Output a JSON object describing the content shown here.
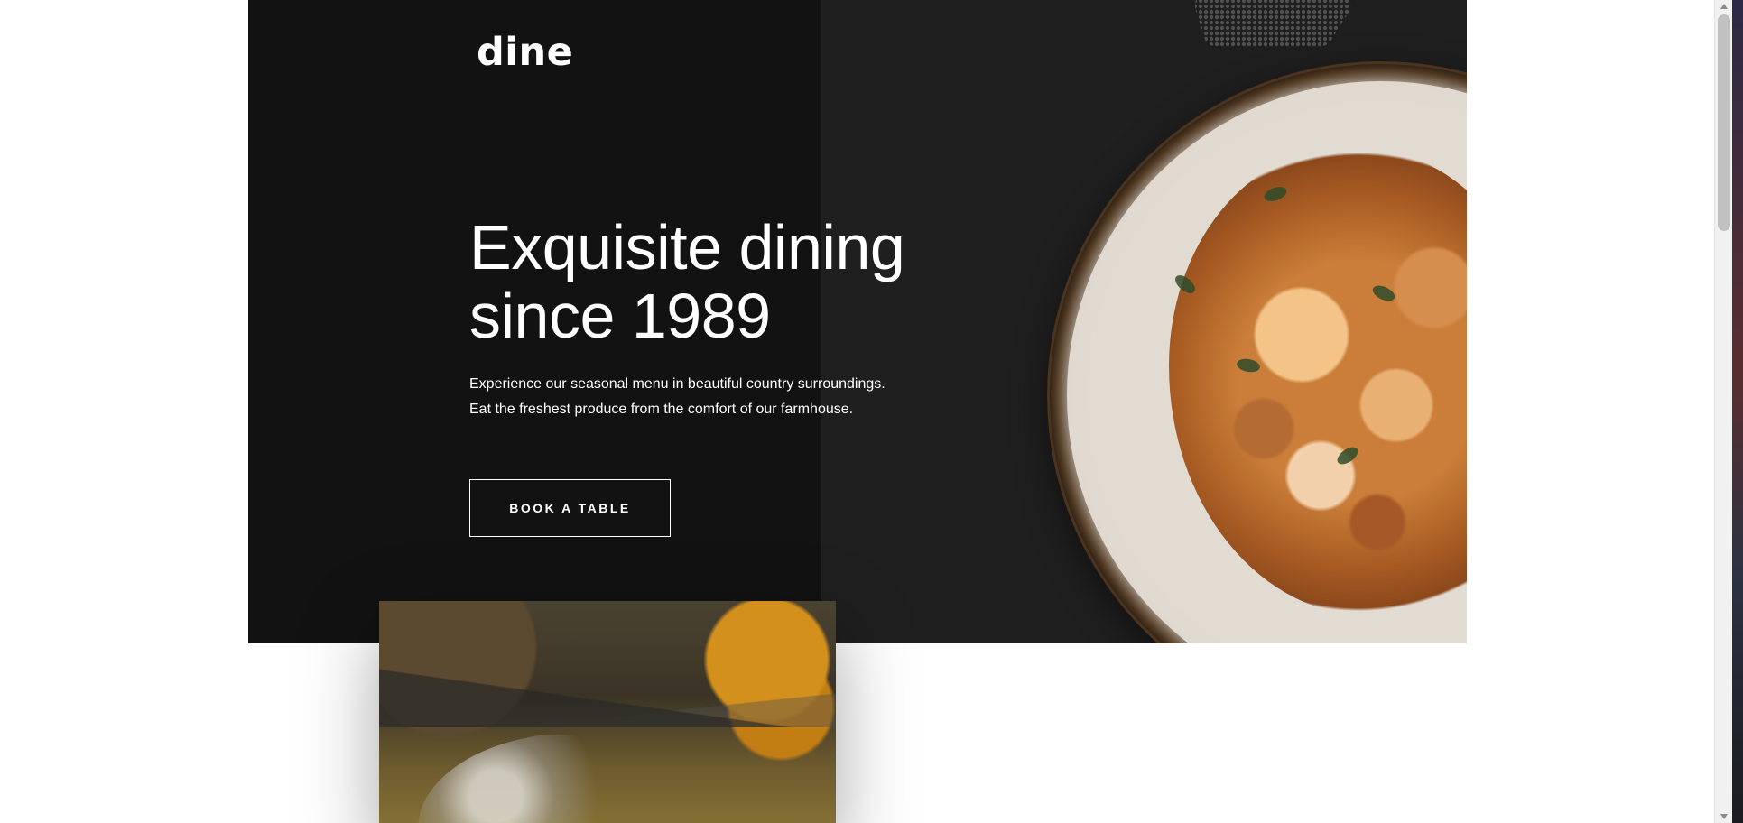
{
  "brand": {
    "logo_text": "dine"
  },
  "hero": {
    "headline": "Exquisite dining since 1989",
    "subtext": "Experience our seasonal menu in beautiful country surroundings. Eat the freshest produce from the comfort of our farmhouse.",
    "cta_label": "BOOK A TABLE"
  },
  "images": {
    "hero_plate": "plated seafood pasta with shrimp on speckled ceramic plate",
    "landscape": "rural landscape with stream and stone walls"
  },
  "colors": {
    "hero_bg": "#1f1f1f",
    "hero_left_bg": "#121212",
    "text_light": "#ffffff",
    "page_bg": "#ffffff"
  }
}
